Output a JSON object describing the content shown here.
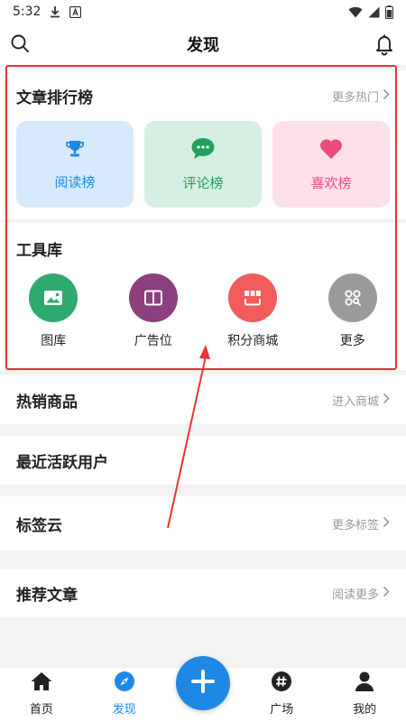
{
  "status_bar": {
    "time": "5:32"
  },
  "header": {
    "title": "发现"
  },
  "rankings": {
    "title": "文章排行榜",
    "more": "更多热门",
    "cards": [
      {
        "label": "阅读榜",
        "icon": "trophy-icon"
      },
      {
        "label": "评论榜",
        "icon": "comment-icon"
      },
      {
        "label": "喜欢榜",
        "icon": "heart-icon"
      }
    ]
  },
  "tools": {
    "title": "工具库",
    "items": [
      {
        "label": "图库",
        "icon": "image-icon",
        "color": "#2eaa6f"
      },
      {
        "label": "广告位",
        "icon": "book-icon",
        "color": "#8e3f7f"
      },
      {
        "label": "积分商城",
        "icon": "shop-icon",
        "color": "#f25c5c"
      },
      {
        "label": "更多",
        "icon": "grid-icon",
        "color": "#9a9a9a"
      }
    ]
  },
  "hot_goods": {
    "title": "热销商品",
    "more": "进入商城"
  },
  "active_users": {
    "title": "最近活跃用户"
  },
  "tag_cloud": {
    "title": "标签云",
    "more": "更多标签"
  },
  "recommended": {
    "title": "推荐文章",
    "more": "阅读更多"
  },
  "nav": {
    "items": [
      {
        "label": "首页",
        "icon": "home-icon"
      },
      {
        "label": "发现",
        "icon": "compass-icon"
      },
      {
        "label": "广场",
        "icon": "hashtag-icon"
      },
      {
        "label": "我的",
        "icon": "profile-icon"
      }
    ],
    "fab_icon": "plus-icon"
  },
  "colors": {
    "accent": "#1e88e5",
    "annotation": "#e8352f"
  }
}
